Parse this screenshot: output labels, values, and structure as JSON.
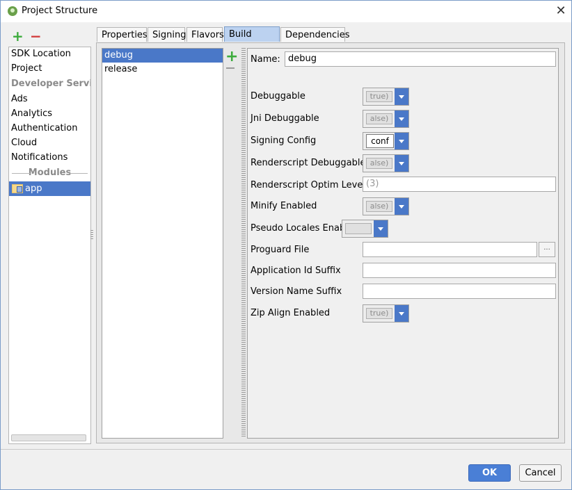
{
  "window": {
    "title": "Project Structure",
    "close_label": "✕"
  },
  "toolbar": {
    "add_label": "+",
    "remove_label": "−"
  },
  "nav": {
    "items": [
      "SDK Location",
      "Project"
    ],
    "developer_services_header": "Developer Services",
    "services": [
      "Ads",
      "Analytics",
      "Authentication",
      "Cloud",
      "Notifications"
    ],
    "modules_header": "Modules",
    "selected_module": "app"
  },
  "tabs": [
    {
      "label": "Properties",
      "active": false
    },
    {
      "label": "Signing",
      "active": false
    },
    {
      "label": "Flavors",
      "active": false
    },
    {
      "label": "Build Types",
      "active": true
    },
    {
      "label": "Dependencies",
      "active": false
    }
  ],
  "build_types": {
    "items": [
      "debug",
      "release"
    ],
    "selected": "debug",
    "add_label": "+"
  },
  "form": {
    "name_label": "Name:",
    "name_value": "debug",
    "fields": {
      "debuggable": {
        "label": "Debuggable",
        "value": "true)"
      },
      "jni_debuggable": {
        "label": "Jni Debuggable",
        "value": "alse)"
      },
      "signing_config": {
        "label": "Signing Config",
        "value": "conf"
      },
      "renderscript_debuggable": {
        "label": "Renderscript Debuggable",
        "value": "alse)"
      },
      "renderscript_optim_level": {
        "label": "Renderscript Optim Level",
        "value": "(3)"
      },
      "minify_enabled": {
        "label": "Minify Enabled",
        "value": "alse)"
      },
      "pseudo_locales_enabled": {
        "label": "Pseudo Locales Enabled",
        "value": ""
      },
      "proguard_file": {
        "label": "Proguard File",
        "value": "",
        "browse_label": "..."
      },
      "application_id_suffix": {
        "label": "Application Id Suffix",
        "value": ""
      },
      "version_name_suffix": {
        "label": "Version Name Suffix",
        "value": ""
      },
      "zip_align_enabled": {
        "label": "Zip Align Enabled",
        "value": "true)"
      }
    }
  },
  "buttons": {
    "ok": "OK",
    "cancel": "Cancel"
  },
  "colors": {
    "accent": "#4a78c8",
    "add_green": "#3cab3c",
    "remove_red": "#d23b3b"
  }
}
